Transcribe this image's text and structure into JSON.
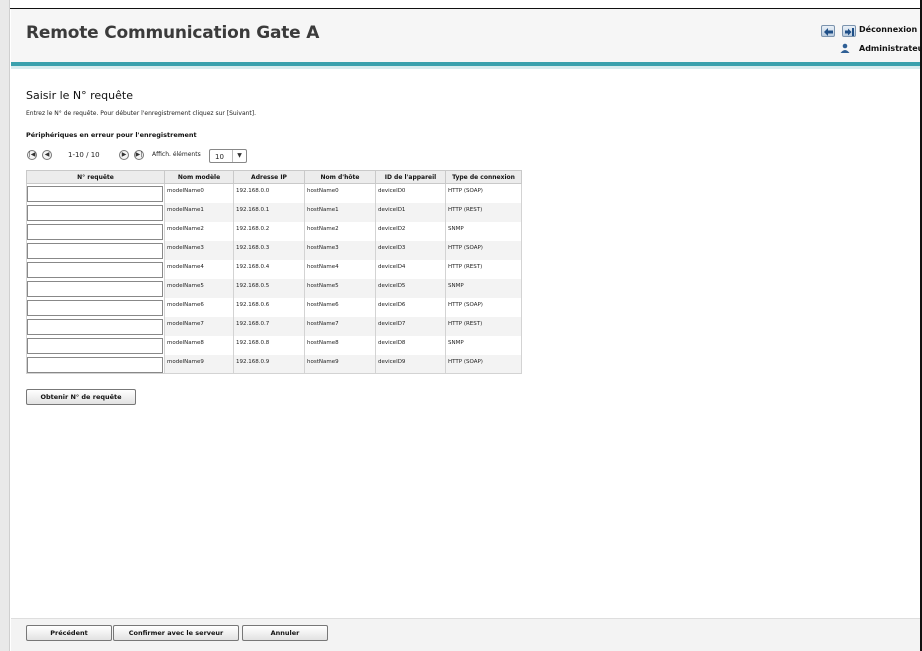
{
  "header": {
    "app_title": "Remote Communication Gate A",
    "logout_label": "Déconnexion",
    "user_label": "Administrateur",
    "accent_color": "#3aa1ad"
  },
  "page": {
    "title": "Saisir le N°  requête",
    "instruction": "Entrez le N°  de requête. Pour débuter l'enregistrement cliquez sur [Suivant].",
    "section_title": "Périphériques en erreur pour l'enregistrement"
  },
  "pager": {
    "first_icon": "first-page-icon",
    "prev_icon": "prev-page-icon",
    "range": "1-10 / 10",
    "next_icon": "next-page-icon",
    "last_icon": "last-page-icon",
    "count_label": "Affich. éléments",
    "count_value": "10"
  },
  "table": {
    "headers": [
      "N°  requête",
      "Nom modèle",
      "Adresse IP",
      "Nom d'hôte",
      "ID de l'appareil",
      "Type de connexion"
    ],
    "rows": [
      {
        "request": "",
        "model": "modelName0",
        "ip": "192.168.0.0",
        "host": "hostName0",
        "device": "deviceID0",
        "conn": "HTTP (SOAP)"
      },
      {
        "request": "",
        "model": "modelName1",
        "ip": "192.168.0.1",
        "host": "hostName1",
        "device": "deviceID1",
        "conn": "HTTP (REST)"
      },
      {
        "request": "",
        "model": "modelName2",
        "ip": "192.168.0.2",
        "host": "hostName2",
        "device": "deviceID2",
        "conn": "SNMP"
      },
      {
        "request": "",
        "model": "modelName3",
        "ip": "192.168.0.3",
        "host": "hostName3",
        "device": "deviceID3",
        "conn": "HTTP (SOAP)"
      },
      {
        "request": "",
        "model": "modelName4",
        "ip": "192.168.0.4",
        "host": "hostName4",
        "device": "deviceID4",
        "conn": "HTTP (REST)"
      },
      {
        "request": "",
        "model": "modelName5",
        "ip": "192.168.0.5",
        "host": "hostName5",
        "device": "deviceID5",
        "conn": "SNMP"
      },
      {
        "request": "",
        "model": "modelName6",
        "ip": "192.168.0.6",
        "host": "hostName6",
        "device": "deviceID6",
        "conn": "HTTP (SOAP)"
      },
      {
        "request": "",
        "model": "modelName7",
        "ip": "192.168.0.7",
        "host": "hostName7",
        "device": "deviceID7",
        "conn": "HTTP (REST)"
      },
      {
        "request": "",
        "model": "modelName8",
        "ip": "192.168.0.8",
        "host": "hostName8",
        "device": "deviceID8",
        "conn": "SNMP"
      },
      {
        "request": "",
        "model": "modelName9",
        "ip": "192.168.0.9",
        "host": "hostName9",
        "device": "deviceID9",
        "conn": "HTTP (SOAP)"
      }
    ]
  },
  "actions": {
    "get_request_label": "Obtenir N°  de requête"
  },
  "footer": {
    "prev_label": "Précédent",
    "confirm_label": "Confirmer avec le serveur",
    "cancel_label": "Annuler"
  }
}
